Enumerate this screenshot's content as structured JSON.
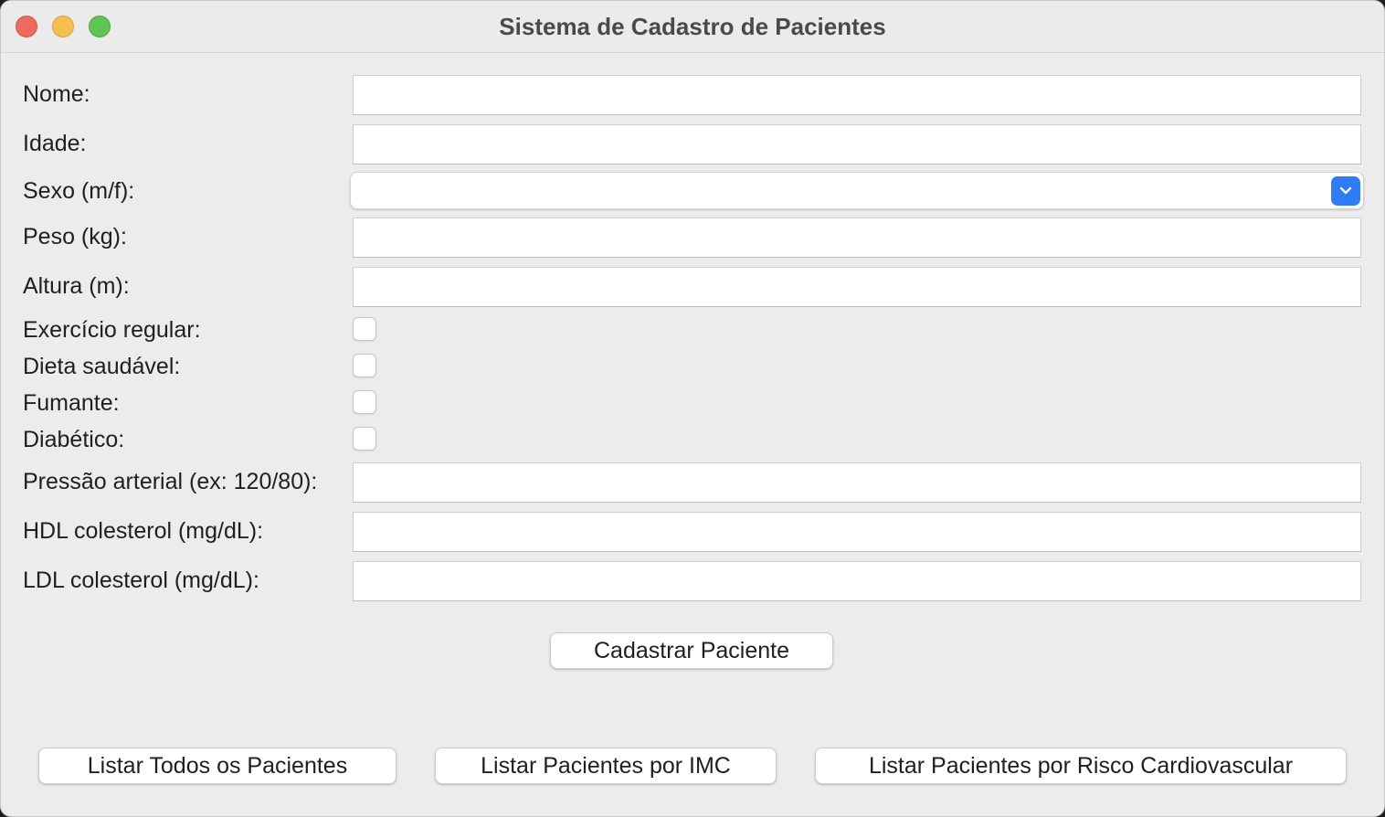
{
  "window": {
    "title": "Sistema de Cadastro de Pacientes"
  },
  "form": {
    "nome": {
      "label": "Nome:",
      "value": ""
    },
    "idade": {
      "label": "Idade:",
      "value": ""
    },
    "sexo": {
      "label": "Sexo (m/f):",
      "value": ""
    },
    "peso": {
      "label": "Peso (kg):",
      "value": ""
    },
    "altura": {
      "label": "Altura (m):",
      "value": ""
    },
    "exercicio": {
      "label": "Exercício regular:",
      "checked": false
    },
    "dieta": {
      "label": "Dieta saudável:",
      "checked": false
    },
    "fumante": {
      "label": "Fumante:",
      "checked": false
    },
    "diabetico": {
      "label": "Diabético:",
      "checked": false
    },
    "pressao": {
      "label": "Pressão arterial (ex: 120/80):",
      "value": ""
    },
    "hdl": {
      "label": "HDL colesterol (mg/dL):",
      "value": ""
    },
    "ldl": {
      "label": "LDL colesterol (mg/dL):",
      "value": ""
    }
  },
  "buttons": {
    "cadastrar": "Cadastrar Paciente",
    "listar_todos": "Listar Todos os Pacientes",
    "listar_imc": "Listar Pacientes por IMC",
    "listar_risco": "Listar Pacientes por Risco Cardiovascular"
  },
  "colors": {
    "window_bg": "#ececec",
    "accent": "#2f7cf6",
    "close": "#ed6a5e",
    "minimize": "#f5bf4f",
    "maximize": "#61c554"
  },
  "icons": {
    "select_arrow": "chevron-down-icon"
  }
}
